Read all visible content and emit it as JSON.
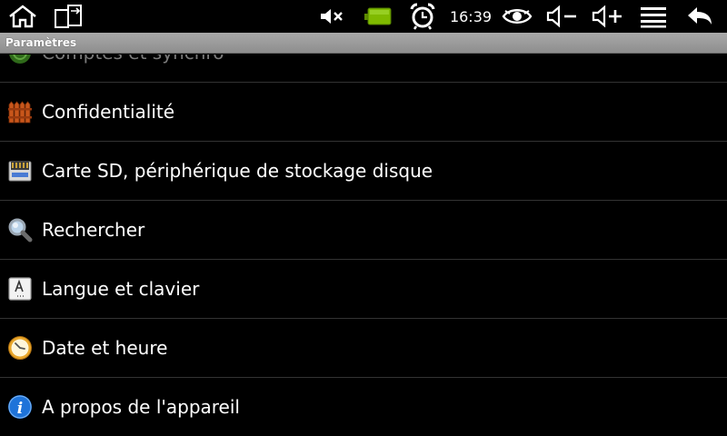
{
  "status_bar": {
    "time": "16:39",
    "icons": [
      "home-icon",
      "rotate-screen-icon",
      "mute-icon",
      "battery-icon",
      "alarm-clock-icon",
      "eye-icon",
      "volume-down-icon",
      "volume-up-icon",
      "menu-icon",
      "back-icon"
    ]
  },
  "title_bar": {
    "title": "Paramètres"
  },
  "settings": {
    "items": [
      {
        "label": "Comptes et synchro",
        "icon": "sync-icon"
      },
      {
        "label": "Confidentialité",
        "icon": "privacy-fence-icon"
      },
      {
        "label": "Carte SD, périphérique de stockage disque",
        "icon": "sd-card-icon"
      },
      {
        "label": "Rechercher",
        "icon": "magnifier-icon"
      },
      {
        "label": "Langue et clavier",
        "icon": "keyboard-language-icon"
      },
      {
        "label": "Date et heure",
        "icon": "clock-icon"
      },
      {
        "label": "A propos de l'appareil",
        "icon": "info-icon"
      }
    ]
  },
  "colors": {
    "background": "#000000",
    "title_bar": "#9c9c9c",
    "battery": "#7fba00",
    "info_blue": "#1e73d9",
    "divider": "#333333"
  }
}
